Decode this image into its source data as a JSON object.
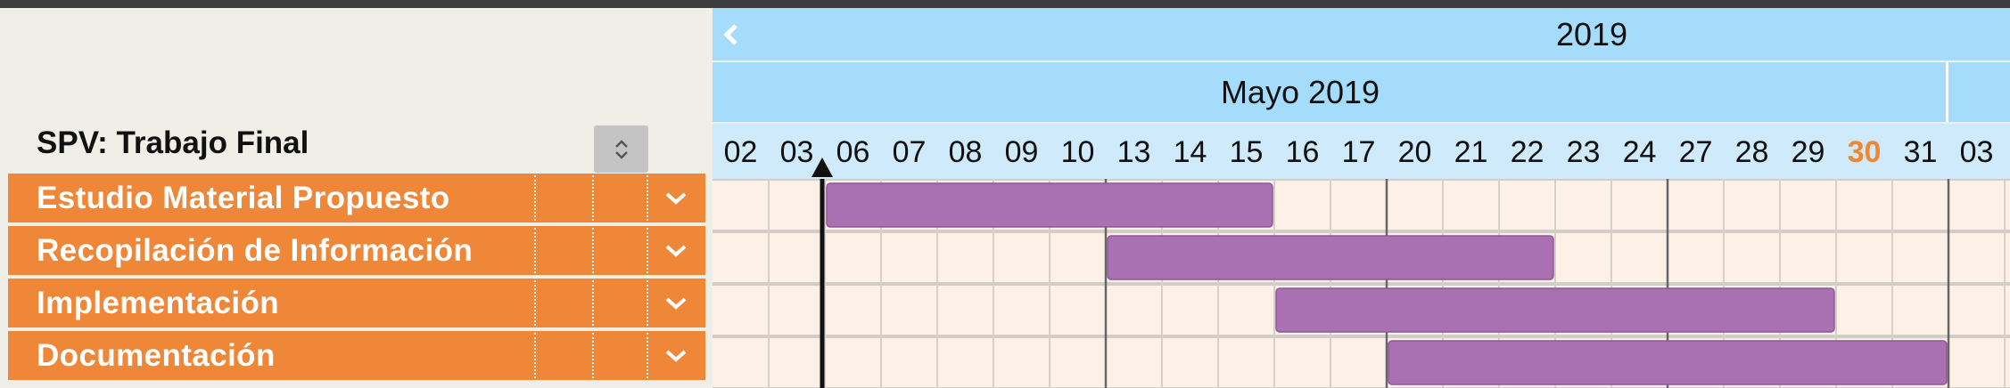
{
  "project": {
    "title": "SPV: Trabajo Final"
  },
  "tasks": [
    {
      "name": "Estudio Material Propuesto",
      "start_day": "06",
      "end_day": "15"
    },
    {
      "name": "Recopilación de Información",
      "start_day": "13",
      "end_day": "22"
    },
    {
      "name": "Implementación",
      "start_day": "16",
      "end_day": "29"
    },
    {
      "name": "Documentación",
      "start_day": "20",
      "end_day": "31"
    }
  ],
  "timeline": {
    "year": "2019",
    "month": "Mayo 2019",
    "days": [
      "02",
      "03",
      "06",
      "07",
      "08",
      "09",
      "10",
      "13",
      "14",
      "15",
      "16",
      "17",
      "20",
      "21",
      "22",
      "23",
      "24",
      "27",
      "28",
      "29",
      "30",
      "31",
      "03"
    ],
    "today": "30",
    "current_marker_day": "06"
  },
  "colors": {
    "task_bar": "#a970b2",
    "task_row_bg": "#ee8737",
    "grid_bg": "#fdf1e7",
    "header_bg": "#a6dcfb",
    "today_text": "#ef8733"
  },
  "icons": {
    "prev": "chevron-left-icon",
    "sort": "sort-arrows-icon",
    "expand": "chevron-down-icon"
  }
}
